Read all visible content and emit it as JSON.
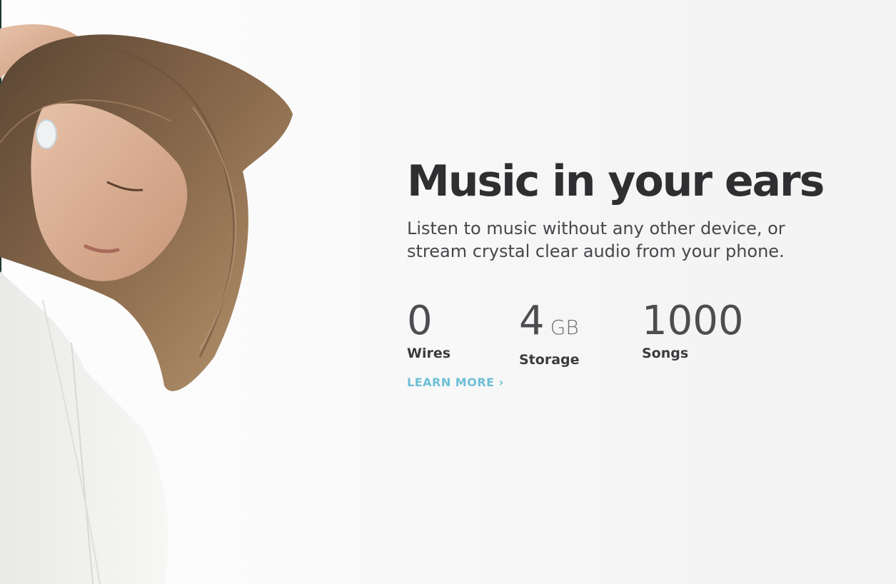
{
  "hero": {
    "title": "Music in your ears",
    "subtitle": "Listen to music without any other device, or stream crystal clear audio from your phone."
  },
  "stats": [
    {
      "value": "0",
      "unit": "",
      "label": "Wires"
    },
    {
      "value": "4",
      "unit": "GB",
      "label": "Storage"
    },
    {
      "value": "1000",
      "unit": "",
      "label": "Songs"
    }
  ],
  "cta": {
    "label": "LEARN MORE",
    "chevron": "›"
  },
  "colors": {
    "title": "#2f2f31",
    "link": "#6cbfd6",
    "background": "#f6f6f6"
  },
  "image": {
    "icon": "woman-with-earbud-photo"
  }
}
